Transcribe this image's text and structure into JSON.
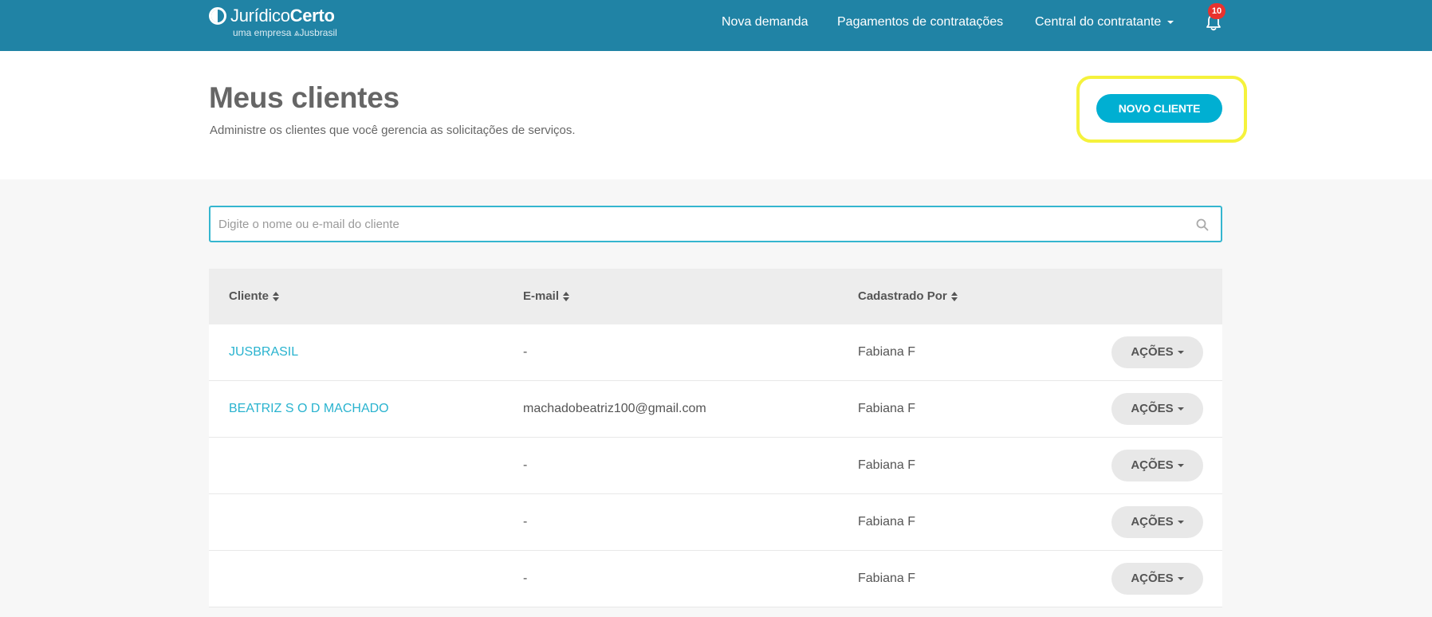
{
  "brand": {
    "name_light": "Jurídico",
    "name_bold": "Certo",
    "tagline": "uma empresa ⩓Jusbrasil"
  },
  "nav": {
    "nova_demanda": "Nova demanda",
    "pagamentos": "Pagamentos de contratações",
    "central": "Central do contratante",
    "notification_count": "10"
  },
  "header": {
    "title": "Meus clientes",
    "subtitle": "Administre os clientes que você gerencia as solicitações de serviços.",
    "new_client_button": "NOVO CLIENTE"
  },
  "search": {
    "placeholder": "Digite o nome ou e-mail do cliente",
    "value": ""
  },
  "table": {
    "columns": {
      "cliente": "Cliente",
      "email": "E-mail",
      "cadastrado_por": "Cadastrado Por"
    },
    "actions_label": "AÇÕES",
    "rows": [
      {
        "cliente": "JUSBRASIL",
        "email": "-",
        "cadastrado_por": "Fabiana F"
      },
      {
        "cliente": "BEATRIZ S O D MACHADO",
        "email": "machadobeatriz100@gmail.com",
        "cadastrado_por": "Fabiana F"
      },
      {
        "cliente": "",
        "email": "-",
        "cadastrado_por": "Fabiana F"
      },
      {
        "cliente": "",
        "email": "-",
        "cadastrado_por": "Fabiana F"
      },
      {
        "cliente": "",
        "email": "-",
        "cadastrado_por": "Fabiana F"
      }
    ]
  },
  "colors": {
    "topbar": "#2083a5",
    "accent": "#00afd2",
    "link": "#29b3cf",
    "highlight": "#f5f23c",
    "badge": "#e8322e"
  }
}
